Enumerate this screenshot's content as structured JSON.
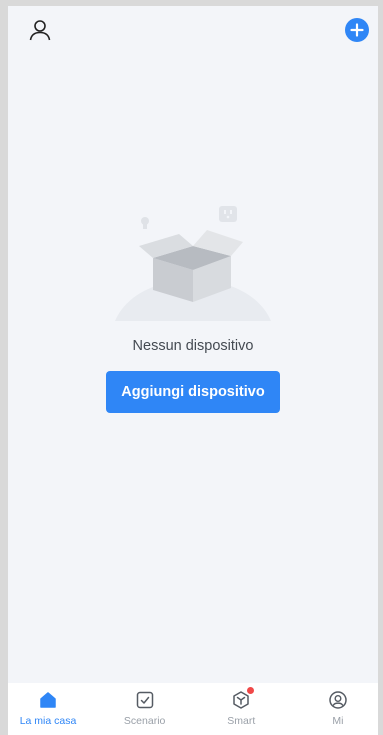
{
  "header": {
    "profile_icon": "user-icon",
    "add_icon": "plus-circle-icon"
  },
  "empty_state": {
    "message": "Nessun dispositivo",
    "button_label": "Aggiungi dispositivo",
    "illustration": "empty-box-illustration"
  },
  "nav": {
    "items": [
      {
        "label": "La mia casa",
        "icon": "home-icon",
        "active": true
      },
      {
        "label": "Scenario",
        "icon": "checkbox-icon",
        "active": false
      },
      {
        "label": "Smart",
        "icon": "cube-icon",
        "active": false,
        "badge": true
      },
      {
        "label": "Mi",
        "icon": "profile-circle-icon",
        "active": false
      }
    ]
  },
  "colors": {
    "accent": "#2f86f6",
    "background": "#f3f5f9",
    "badge": "#f04848",
    "nav_inactive": "#9aa0a8"
  }
}
